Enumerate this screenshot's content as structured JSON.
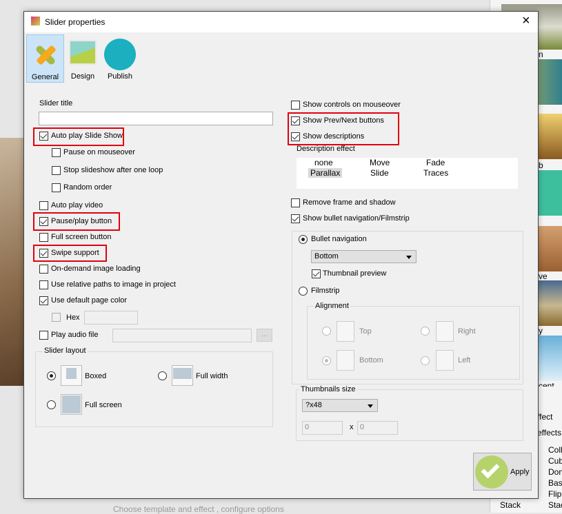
{
  "dialog": {
    "title": "Slider properties",
    "close": "×"
  },
  "tabs": [
    {
      "label": "General",
      "active": true
    },
    {
      "label": "Design"
    },
    {
      "label": "Publish"
    }
  ],
  "left": {
    "slider_title_label": "Slider title",
    "slider_title_value": "",
    "auto_play": {
      "label": "Auto play Slide Show",
      "checked": true
    },
    "pause_mouseover": {
      "label": "Pause on mouseover",
      "checked": false
    },
    "stop_after_loop": {
      "label": "Stop slideshow after one loop",
      "checked": false
    },
    "random_order": {
      "label": "Random order",
      "checked": false
    },
    "auto_play_video": {
      "label": "Auto play video",
      "checked": false
    },
    "pause_play_button": {
      "label": "Pause/play button",
      "checked": true
    },
    "full_screen_button": {
      "label": "Full screen button",
      "checked": false
    },
    "swipe_support": {
      "label": "Swipe support",
      "checked": true
    },
    "on_demand": {
      "label": "On-demand image loading",
      "checked": false
    },
    "relative_paths": {
      "label": "Use relative paths to image in project",
      "checked": false
    },
    "default_page_color": {
      "label": "Use default page color",
      "checked": true
    },
    "hex": {
      "label": "Hex",
      "value": ""
    },
    "play_audio": {
      "label": "Play audio file",
      "value": "",
      "browse": "..."
    },
    "layout": {
      "label": "Slider layout",
      "options": [
        "Boxed",
        "Full width",
        "Full screen"
      ],
      "selected": "Boxed"
    }
  },
  "right": {
    "show_controls": {
      "label": "Show controls on mouseover",
      "checked": false
    },
    "show_prev_next": {
      "label": "Show Prev/Next buttons",
      "checked": true
    },
    "show_descriptions": {
      "label": "Show descriptions",
      "checked": true
    },
    "description_effect": {
      "label": "Description effect",
      "options": [
        "none",
        "Move",
        "Fade",
        "Parallax",
        "Slide",
        "Traces"
      ],
      "selected": "Parallax"
    },
    "remove_frame": {
      "label": "Remove frame and shadow",
      "checked": false
    },
    "show_bullet": {
      "label": "Show bullet navigation/Filmstrip",
      "checked": true
    },
    "bullet_nav": {
      "label": "Bullet navigation",
      "selected": true,
      "position": "Bottom",
      "thumbnail_preview": "Thumbnail preview"
    },
    "filmstrip": {
      "label": "Filmstrip",
      "selected": false
    },
    "alignment": {
      "label": "Alignment",
      "options": [
        "Top",
        "Right",
        "Bottom",
        "Left"
      ],
      "selected": "Bottom"
    },
    "thumbnails_size": {
      "label": "Thumbnails size",
      "value": "?x48",
      "width": "0",
      "height": "0",
      "x": "x"
    }
  },
  "apply_label": "Apply",
  "background": {
    "status_text": "Choose template and effect , configure options",
    "right_labels": [
      "n",
      "b",
      "ve",
      "y",
      "cent",
      "ffect",
      "effects",
      "Coll",
      "Cub",
      "Don",
      "Basi",
      "Flip",
      "Stac",
      "Stack"
    ]
  },
  "colors": {
    "highlight": "#e00010",
    "accent": "#b6d36b",
    "tab_active": "#cce4f7"
  }
}
